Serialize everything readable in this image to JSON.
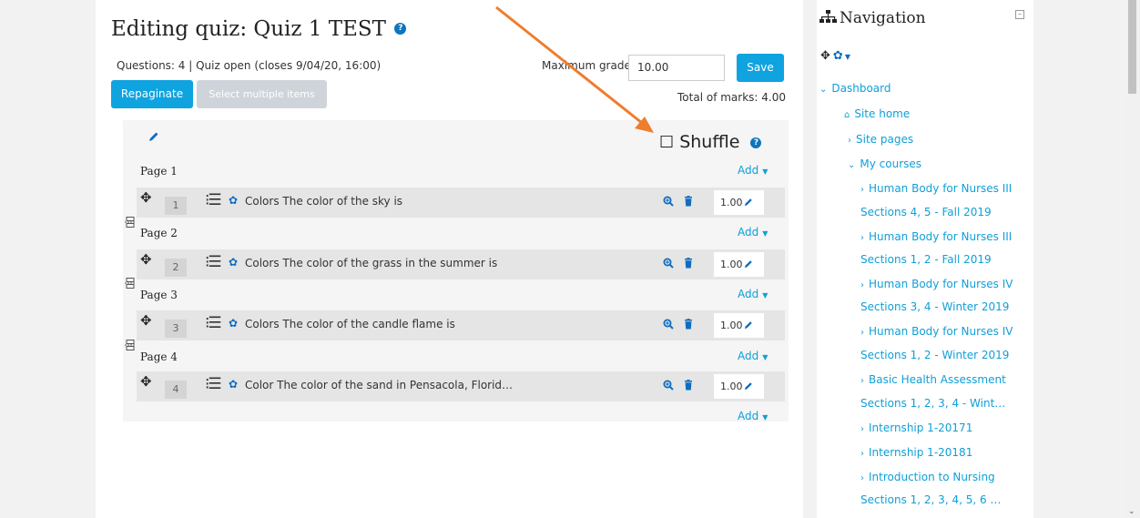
{
  "main": {
    "title": "Editing quiz: Quiz 1 TEST",
    "status_line": "Questions: 4 | Quiz open (closes 9/04/20, 16:00)",
    "max_grade_label": "Maximum grade",
    "max_grade_value": "10.00",
    "save_label": "Save",
    "repaginate_label": "Repaginate",
    "select_multiple_label": "Select multiple items",
    "total_marks": "Total of marks: 4.00",
    "shuffle_label": "Shuffle",
    "add_label": "Add",
    "pages": [
      {
        "label": "Page 1"
      },
      {
        "label": "Page 2"
      },
      {
        "label": "Page 3"
      },
      {
        "label": "Page 4"
      }
    ],
    "questions": [
      {
        "number": "1",
        "text": "Colors The color of the sky is",
        "mark": "1.00"
      },
      {
        "number": "2",
        "text": "Colors The color of the grass in the summer is",
        "mark": "1.00"
      },
      {
        "number": "3",
        "text": "Colors The color of the candle flame is",
        "mark": "1.00"
      },
      {
        "number": "4",
        "text": "Color The color of the sand in Pensacola, Florid…",
        "mark": "1.00"
      }
    ]
  },
  "navigation": {
    "title": "Navigation",
    "items": [
      "Dashboard",
      "Site home",
      "Site pages",
      "My courses",
      "Human Body for Nurses III",
      "Sections 4, 5 - Fall 2019",
      "Human Body for Nurses III",
      "Sections 1, 2 - Fall 2019",
      "Human Body for Nurses IV",
      "Sections 3, 4 - Winter 2019",
      "Human Body for Nurses IV",
      "Sections 1, 2 - Winter 2019",
      "Basic Health Assessment",
      "Sections 1, 2, 3, 4 - Wint…",
      "Internship 1-20171",
      "Internship 1-20181",
      "Introduction to Nursing",
      "Sections 1, 2, 3, 4, 5, 6 …"
    ]
  },
  "colors": {
    "primary_button": "#0fa3e0",
    "link": "#0f9fd8",
    "annotation_arrow": "#ee7d2e"
  }
}
